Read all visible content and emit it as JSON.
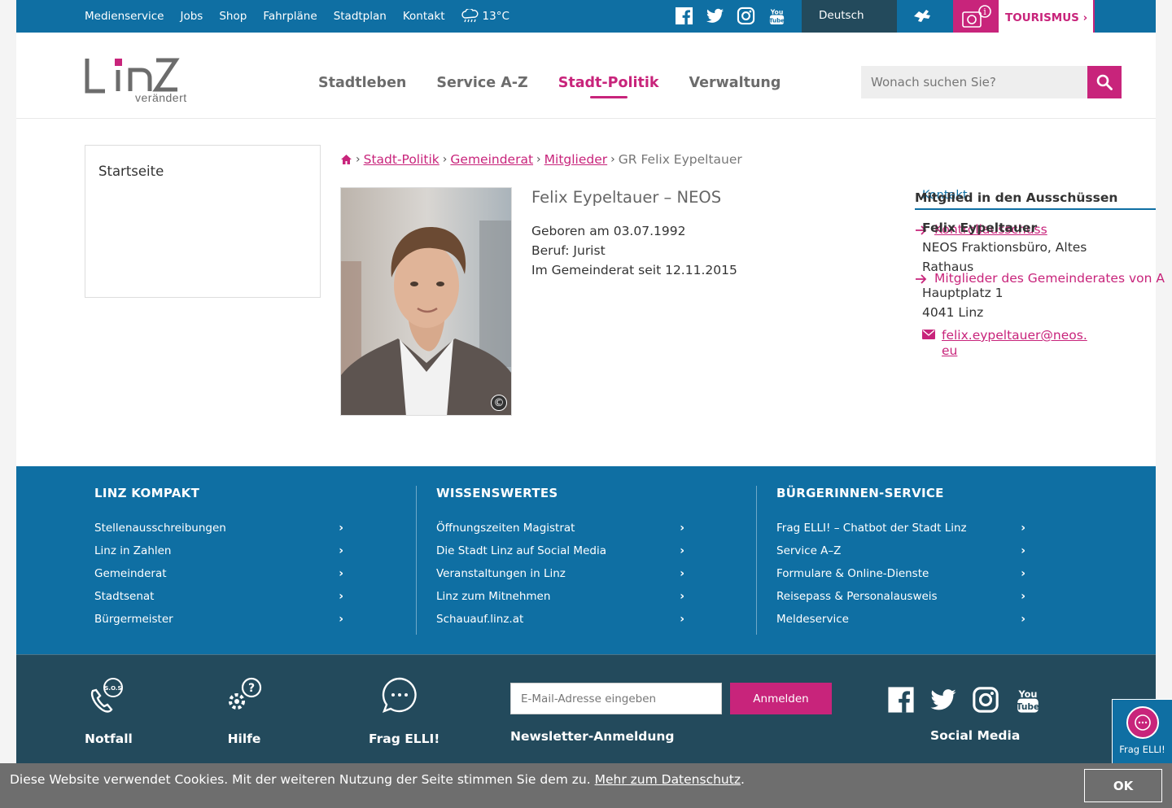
{
  "topbar": {
    "links": [
      "Medienservice",
      "Jobs",
      "Shop",
      "Fahrpläne",
      "Stadtplan",
      "Kontakt"
    ],
    "weather": "13°C",
    "language": "Deutsch",
    "tourism_label": "TOURISMUS"
  },
  "header": {
    "logo_word": "Linz",
    "logo_tagline": "verändert",
    "nav": [
      "Stadtleben",
      "Service A-Z",
      "Stadt-Politik",
      "Verwaltung"
    ],
    "active_nav": "Stadt-Politik",
    "search_placeholder": "Wonach suchen Sie?"
  },
  "sidebar": {
    "items": [
      "Startseite"
    ]
  },
  "breadcrumb": {
    "items": [
      "Stadt-Politik",
      "Gemeinderat",
      "Mitglieder"
    ],
    "current": "GR Felix Eypeltauer"
  },
  "person": {
    "name": "Felix Eypeltauer – NEOS",
    "born": "Geboren am 03.07.1992",
    "job": "Beruf: Jurist",
    "council_since": "Im Gemeinderat seit 12.11.2015",
    "photo_copyright": "©"
  },
  "committees": {
    "kontakt_label": "Kontakt",
    "title": "Mitglied in den Ausschüssen",
    "items": [
      "Kontrollausschuss",
      "Mitglieder des Gemeinderates von A"
    ]
  },
  "contact": {
    "name": "Felix Eypeltauer",
    "org_line1": "NEOS Fraktionsbüro, Altes",
    "org_line2": "Rathaus",
    "street": "Hauptplatz 1",
    "city": "4041 Linz",
    "email": "felix.eypeltauer@neos.eu"
  },
  "footer": {
    "columns": [
      {
        "title": "LINZ KOMPAKT",
        "links": [
          "Stellenausschreibungen",
          "Linz in Zahlen",
          "Gemeinderat",
          "Stadtsenat",
          "Bürgermeister"
        ]
      },
      {
        "title": "WISSENSWERTES",
        "links": [
          "Öffnungszeiten Magistrat",
          "Die Stadt Linz auf Social Media",
          "Veranstaltungen in Linz",
          "Linz zum Mitnehmen",
          "Schauauf.linz.at"
        ]
      },
      {
        "title": "BÜRGERINNEN-SERVICE",
        "links": [
          "Frag ELLI! – Chatbot der Stadt Linz",
          "Service A–Z",
          "Formulare & Online-Dienste",
          "Reisepass & Personalausweis",
          "Meldeservice"
        ]
      }
    ],
    "quick": {
      "notfall": "Notfall",
      "sos": "S.O.S",
      "hilfe": "Hilfe",
      "frag_elli": "Frag ELLI!",
      "newsletter_title": "Newsletter-Anmeldung",
      "newsletter_placeholder": "E-Mail-Adresse eingeben",
      "newsletter_button": "Anmelden",
      "social_media": "Social Media"
    }
  },
  "cookie": {
    "text": "Diese Website verwendet Cookies. Mit der weiteren Nutzung der Seite stimmen Sie dem zu.",
    "link": "Mehr zum Datenschutz",
    "period": ".",
    "button": "OK"
  },
  "chat_widget": {
    "label": "Frag ELLI!"
  },
  "colors": {
    "blue": "#0f6fa3",
    "dark_blue": "#234a5c",
    "magenta": "#c8247b",
    "grey": "#6e6e6e"
  }
}
